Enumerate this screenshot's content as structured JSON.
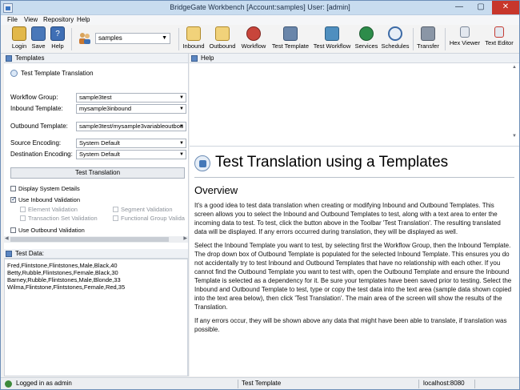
{
  "window": {
    "title": "BridgeGate Workbench [Account:samples] User: [admin]",
    "controls": {
      "minimize": "—",
      "maximize": "▢",
      "close": "✕"
    }
  },
  "menu": [
    "File",
    "View",
    "Repository",
    "Help"
  ],
  "toolbar": {
    "login": "Login",
    "save": "Save",
    "help": "Help",
    "user_value": "samples",
    "inbound": "Inbound",
    "outbound": "Outbound",
    "workflow": "Workflow",
    "test_template": "Test Template",
    "test_workflow": "Test Workflow",
    "services": "Services",
    "schedules": "Schedules",
    "transfer": "Transfer",
    "hex_viewer": "Hex Viewer",
    "text_editor": "Text Editor"
  },
  "left": {
    "templates_header": "Templates",
    "form_title": "Test Template Translation",
    "workflow_group_label": "Workflow Group:",
    "workflow_group_value": "sample3test",
    "inbound_template_label": "Inbound Template:",
    "inbound_template_value": "mysample3inbound",
    "outbound_template_label": "Outbound Template:",
    "outbound_template_value": "sample3test/mysample3variableoutbou",
    "source_encoding_label": "Source Encoding:",
    "source_encoding_value": "System Default",
    "destination_encoding_label": "Destination Encoding:",
    "destination_encoding_value": "System Default",
    "test_button": "Test Translation",
    "display_system_details": "Display System Details",
    "use_inbound_validation": "Use Inbound Validation",
    "element_validation": "Element Validation",
    "segment_validation": "Segment Validation",
    "transaction_set_validation": "Transaction Set Validation",
    "functional_group_validation": "Functional Group Valida",
    "use_outbound_validation": "Use Outbound Validation",
    "test_data_header": "Test Data:",
    "test_data_lines": [
      "Fred,Flintstone,Flintstones,Male,Black,40",
      "Betty,Rubble,Flintstones,Female,Black,30",
      "Barney,Rubble,Flintstones,Male,Blonde,33",
      "Wilma,Flintstone,Flintstones,Female,Red,35"
    ]
  },
  "right": {
    "help_header": "Help",
    "help_title": "Test Translation using a Templates",
    "help_subtitle": "Overview",
    "paragraphs": [
      "It's a good idea to test data translation when creating or modifying Inbound and Outbound Templates. This screen allows you to select the Inbound and Outbound Templates to test, along with a text area to enter the incoming data to test. To test, click the button above in the Toolbar 'Test Translation'. The resulting translated data will be displayed. If any errors occurred during translation, they will be displayed as well.",
      "Select the Inbound Template you want to test, by selecting first the Workflow Group, then the Inbound Template. The drop down box of Outbound Template is populated for the selected Inbound Template. This ensures you do not accidentally try to test Inbound and Outbound Templates that have no relationship with each other. If you cannot find the Outbound Template you want to test with, open the Outbound Template and ensure the Inbound Template is selected as a dependency for it. Be sure your templates have been saved prior to testing. Select the Inbound and Outbound Template to test, type or copy the test data into the text area (sample data shown copied into the text area below), then click 'Test Translation'. The main area of the screen will show the results of the Translation.",
      "If any errors occur, they will be shown above any data that might have been able to translate, if translation was possible."
    ]
  },
  "status": {
    "logged_in": "Logged in as admin",
    "screen": "Test Template",
    "server": "localhost:8080"
  }
}
